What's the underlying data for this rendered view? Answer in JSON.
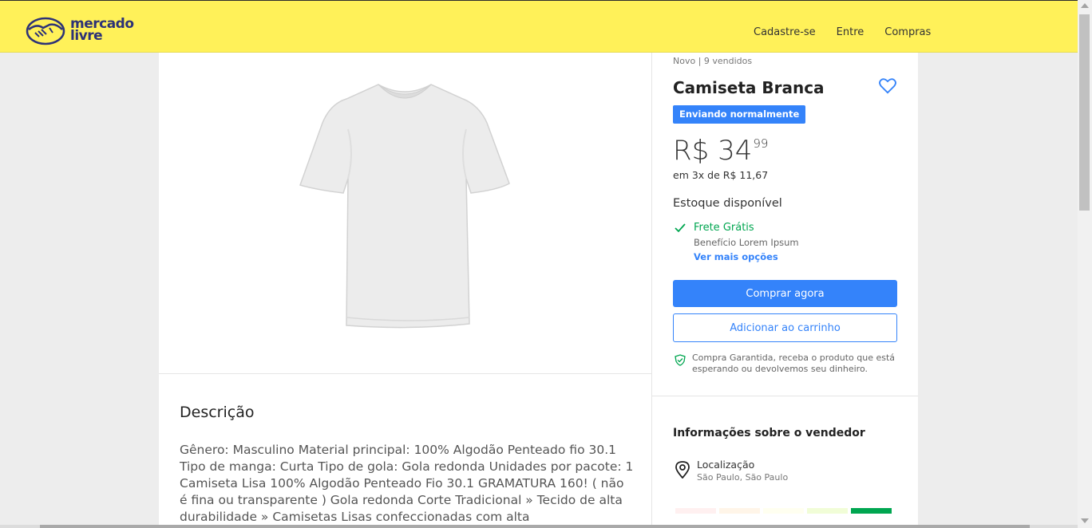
{
  "header": {
    "logo_line1": "mercado",
    "logo_line2": "livre",
    "nav": [
      "Cadastre-se",
      "Entre",
      "Compras"
    ]
  },
  "product": {
    "condition": "Novo | 9 vendidos",
    "title": "Camiseta Branca",
    "badge": "Enviando normalmente",
    "price_main": "R$ 34",
    "price_cents": "99",
    "installments": "em 3x de R$ 11,67",
    "stock": "Estoque disponível",
    "shipping": {
      "title": "Frete Grátis",
      "subtitle": "Benefício Lorem Ipsum",
      "more": "Ver mais opções"
    },
    "buy_label": "Comprar agora",
    "cart_label": "Adicionar ao carrinho",
    "guarantee": "Compra Garantida, receba o produto que está esperando ou devolvemos seu dinheiro."
  },
  "description": {
    "title": "Descrição",
    "body": "Gênero: Masculino Material principal: 100% Algodão Penteado fio 30.1 Tipo de manga: Curta Tipo de gola: Gola redonda Unidades por pacote: 1 Camiseta Lisa 100% Algodão Penteado Fio 30.1 GRAMATURA 160! ( não é fina ou transparente ) Gola redonda Corte Tradicional » Tecido de alta durabilidade » Camisetas Lisas confeccionadas com alta"
  },
  "seller": {
    "title": "Informações sobre o vendedor",
    "location_label": "Localização",
    "location_value": "São Paulo, São Paulo",
    "reputation_colors": [
      "#fff0f0",
      "#fff5e8",
      "#fffff0",
      "#f1fdd7",
      "#00a650"
    ]
  },
  "colors": {
    "header_bg": "#fff159",
    "accent": "#3483fa",
    "success": "#00a650"
  },
  "icons": {
    "logo": "handshake-icon",
    "favorite": "heart-icon",
    "shipping": "check-icon",
    "guarantee": "shield-check-icon",
    "location": "map-pin-icon"
  }
}
